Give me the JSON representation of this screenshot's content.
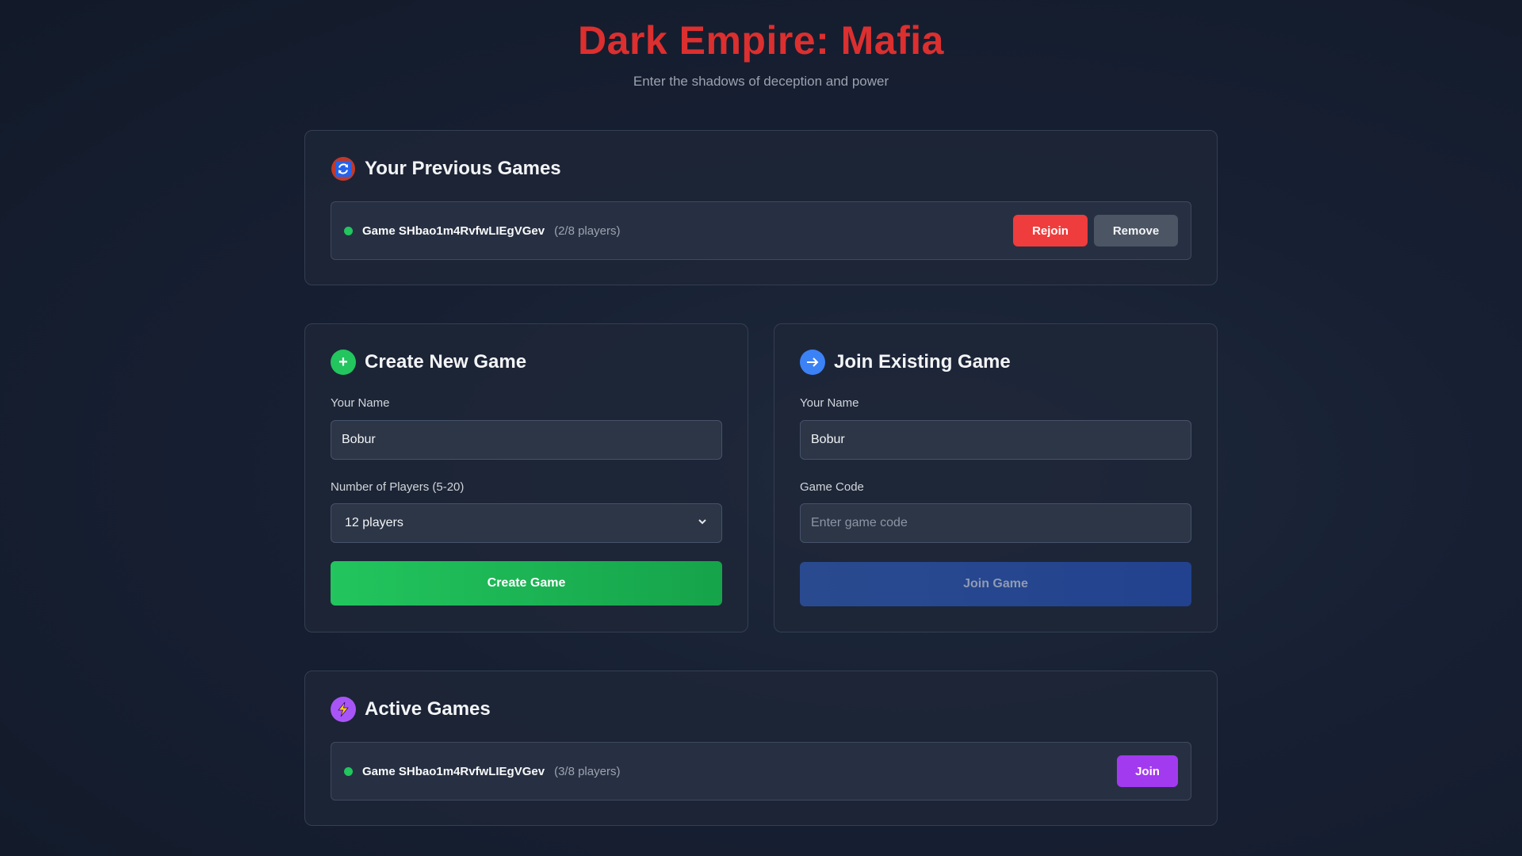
{
  "header": {
    "title": "Dark Empire: Mafia",
    "subtitle": "Enter the shadows of deception and power"
  },
  "previous_games": {
    "title": "Your Previous Games",
    "icon": "refresh-icon",
    "games": [
      {
        "name": "Game SHbao1m4RvfwLIEgVGev",
        "players": "(2/8 players)",
        "status_color": "#22c55e",
        "rejoin_label": "Rejoin",
        "remove_label": "Remove"
      }
    ]
  },
  "create_game": {
    "title": "Create New Game",
    "icon": "plus-icon",
    "name_label": "Your Name",
    "name_value": "Bobur",
    "players_label": "Number of Players (5-20)",
    "players_value": "12 players",
    "button_label": "Create Game"
  },
  "join_game": {
    "title": "Join Existing Game",
    "icon": "arrow-right-icon",
    "name_label": "Your Name",
    "name_value": "Bobur",
    "code_label": "Game Code",
    "code_placeholder": "Enter game code",
    "button_label": "Join Game"
  },
  "active_games": {
    "title": "Active Games",
    "icon": "lightning-icon",
    "games": [
      {
        "name": "Game SHbao1m4RvfwLIEgVGev",
        "players": "(3/8 players)",
        "status_color": "#22c55e",
        "join_label": "Join"
      }
    ]
  },
  "colors": {
    "title_red": "#dc2f2f",
    "rejoin_red": "#ef3c3c",
    "create_green": "#22c55e",
    "join_blue": "#2a4a8f",
    "join_purple": "#a23bf0"
  }
}
